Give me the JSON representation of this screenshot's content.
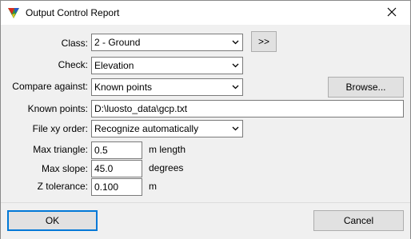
{
  "window": {
    "title": "Output Control Report"
  },
  "form": {
    "class": {
      "label": "Class:",
      "value": "2 - Ground",
      "more_button": ">>"
    },
    "check": {
      "label": "Check:",
      "value": "Elevation"
    },
    "compare_against": {
      "label": "Compare against:",
      "value": "Known points",
      "browse_button": "Browse..."
    },
    "known_points": {
      "label": "Known points:",
      "value": "D:\\luosto_data\\gcp.txt"
    },
    "file_xy_order": {
      "label": "File xy order:",
      "value": "Recognize automatically"
    },
    "max_triangle": {
      "label": "Max triangle:",
      "value": "0.5",
      "unit": "m length"
    },
    "max_slope": {
      "label": "Max slope:",
      "value": "45.0",
      "unit": "degrees"
    },
    "z_tolerance": {
      "label": "Z tolerance:",
      "value": "0.100",
      "unit": "m"
    }
  },
  "footer": {
    "ok_label": "OK",
    "cancel_label": "Cancel"
  },
  "icons": {
    "app": "app-triangle-icon",
    "close": "close-icon",
    "dropdown": "chevron-down-icon"
  }
}
